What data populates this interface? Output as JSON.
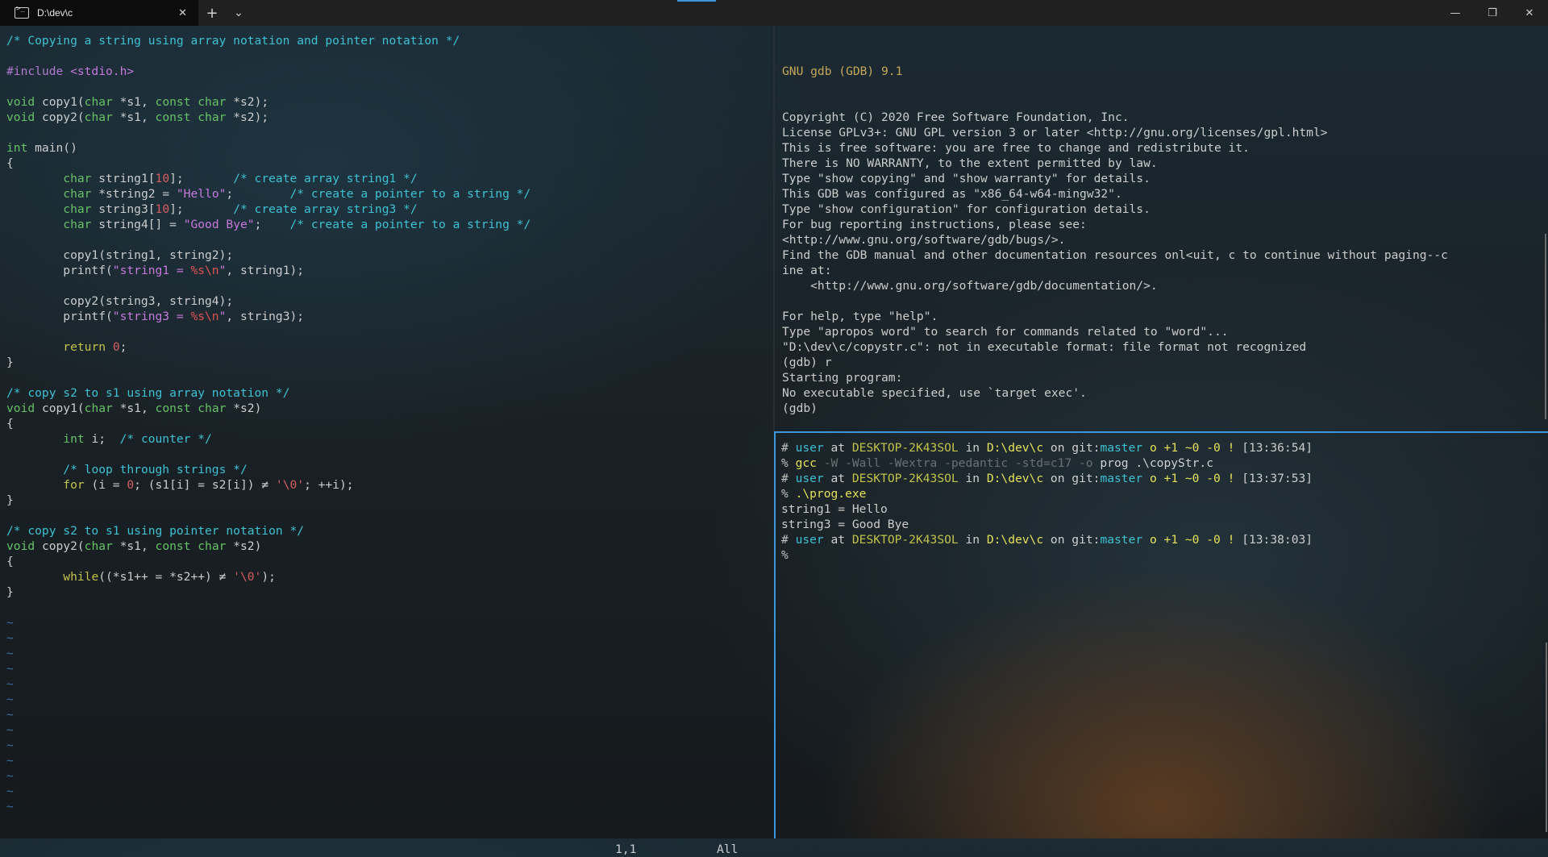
{
  "window": {
    "tab_title": "D:\\dev\\c",
    "tab_close": "✕",
    "new_tab": "+",
    "dropdown": "⌄",
    "minimize": "—",
    "maximize": "❐",
    "close": "✕"
  },
  "editor": {
    "lines": [
      [
        [
          "cmt",
          "/* Copying a string using array notation and pointer notation */"
        ]
      ],
      [],
      [
        [
          "pre",
          "#include "
        ],
        [
          "str",
          "<stdio.h>"
        ]
      ],
      [],
      [
        [
          "type",
          "void"
        ],
        [
          "fn",
          " copy1("
        ],
        [
          "type",
          "char"
        ],
        [
          "fn",
          " *s1, "
        ],
        [
          "type",
          "const char"
        ],
        [
          "fn",
          " *s2);"
        ]
      ],
      [
        [
          "type",
          "void"
        ],
        [
          "fn",
          " copy2("
        ],
        [
          "type",
          "char"
        ],
        [
          "fn",
          " *s1, "
        ],
        [
          "type",
          "const char"
        ],
        [
          "fn",
          " *s2);"
        ]
      ],
      [],
      [
        [
          "type",
          "int"
        ],
        [
          "fn",
          " main()"
        ]
      ],
      [
        [
          "fn",
          "{"
        ]
      ],
      [
        [
          "fn",
          "        "
        ],
        [
          "type",
          "char"
        ],
        [
          "fn",
          " string1["
        ],
        [
          "num",
          "10"
        ],
        [
          "fn",
          "];       "
        ],
        [
          "cmt",
          "/* create array string1 */"
        ]
      ],
      [
        [
          "fn",
          "        "
        ],
        [
          "type",
          "char"
        ],
        [
          "fn",
          " *string2 = "
        ],
        [
          "str",
          "\"Hello\""
        ],
        [
          "fn",
          ";        "
        ],
        [
          "cmt",
          "/* create a pointer to a string */"
        ]
      ],
      [
        [
          "fn",
          "        "
        ],
        [
          "type",
          "char"
        ],
        [
          "fn",
          " string3["
        ],
        [
          "num",
          "10"
        ],
        [
          "fn",
          "];       "
        ],
        [
          "cmt",
          "/* create array string3 */"
        ]
      ],
      [
        [
          "fn",
          "        "
        ],
        [
          "type",
          "char"
        ],
        [
          "fn",
          " string4[] = "
        ],
        [
          "str",
          "\"Good Bye\""
        ],
        [
          "fn",
          ";    "
        ],
        [
          "cmt",
          "/* create a pointer to a string */"
        ]
      ],
      [],
      [
        [
          "fn",
          "        copy1(string1, string2);"
        ]
      ],
      [
        [
          "fn",
          "        printf("
        ],
        [
          "str",
          "\"string1 = "
        ],
        [
          "esc",
          "%s\\n"
        ],
        [
          "str",
          "\""
        ],
        [
          "fn",
          ", string1);"
        ]
      ],
      [],
      [
        [
          "fn",
          "        copy2(string3, string4);"
        ]
      ],
      [
        [
          "fn",
          "        printf("
        ],
        [
          "str",
          "\"string3 = "
        ],
        [
          "esc",
          "%s\\n"
        ],
        [
          "str",
          "\""
        ],
        [
          "fn",
          ", string3);"
        ]
      ],
      [],
      [
        [
          "fn",
          "        "
        ],
        [
          "kw",
          "return"
        ],
        [
          "fn",
          " "
        ],
        [
          "num",
          "0"
        ],
        [
          "fn",
          ";"
        ]
      ],
      [
        [
          "fn",
          "}"
        ]
      ],
      [],
      [
        [
          "cmt",
          "/* copy s2 to s1 using array notation */"
        ]
      ],
      [
        [
          "type",
          "void"
        ],
        [
          "fn",
          " copy1("
        ],
        [
          "type",
          "char"
        ],
        [
          "fn",
          " *s1, "
        ],
        [
          "type",
          "const char"
        ],
        [
          "fn",
          " *s2)"
        ]
      ],
      [
        [
          "fn",
          "{"
        ]
      ],
      [
        [
          "fn",
          "        "
        ],
        [
          "type",
          "int"
        ],
        [
          "fn",
          " i;  "
        ],
        [
          "cmt",
          "/* counter */"
        ]
      ],
      [],
      [
        [
          "fn",
          "        "
        ],
        [
          "cmt",
          "/* loop through strings */"
        ]
      ],
      [
        [
          "fn",
          "        "
        ],
        [
          "kw",
          "for"
        ],
        [
          "fn",
          " (i = "
        ],
        [
          "num",
          "0"
        ],
        [
          "fn",
          "; (s1[i] = s2[i]) ≠ "
        ],
        [
          "num",
          "'\\0'"
        ],
        [
          "fn",
          "; ++i);"
        ]
      ],
      [
        [
          "fn",
          "}"
        ]
      ],
      [],
      [
        [
          "cmt",
          "/* copy s2 to s1 using pointer notation */"
        ]
      ],
      [
        [
          "type",
          "void"
        ],
        [
          "fn",
          " copy2("
        ],
        [
          "type",
          "char"
        ],
        [
          "fn",
          " *s1, "
        ],
        [
          "type",
          "const char"
        ],
        [
          "fn",
          " *s2)"
        ]
      ],
      [
        [
          "fn",
          "{"
        ]
      ],
      [
        [
          "fn",
          "        "
        ],
        [
          "kw",
          "while"
        ],
        [
          "fn",
          "((*s1++ = *s2++) ≠ "
        ],
        [
          "num",
          "'\\0'"
        ],
        [
          "fn",
          ");"
        ]
      ],
      [
        [
          "fn",
          "}"
        ]
      ],
      [],
      [
        [
          "tilde",
          "~"
        ]
      ],
      [
        [
          "tilde",
          "~"
        ]
      ],
      [
        [
          "tilde",
          "~"
        ]
      ],
      [
        [
          "tilde",
          "~"
        ]
      ],
      [
        [
          "tilde",
          "~"
        ]
      ],
      [
        [
          "tilde",
          "~"
        ]
      ],
      [
        [
          "tilde",
          "~"
        ]
      ],
      [
        [
          "tilde",
          "~"
        ]
      ],
      [
        [
          "tilde",
          "~"
        ]
      ],
      [
        [
          "tilde",
          "~"
        ]
      ],
      [
        [
          "tilde",
          "~"
        ]
      ],
      [
        [
          "tilde",
          "~"
        ]
      ],
      [
        [
          "tilde",
          "~"
        ]
      ]
    ],
    "status_position": "1,1",
    "status_scroll": "All"
  },
  "gdb": {
    "title": "GNU gdb (GDB) 9.1",
    "lines": [
      "Copyright (C) 2020 Free Software Foundation, Inc.",
      "License GPLv3+: GNU GPL version 3 or later <http://gnu.org/licenses/gpl.html>",
      "This is free software: you are free to change and redistribute it.",
      "There is NO WARRANTY, to the extent permitted by law.",
      "Type \"show copying\" and \"show warranty\" for details.",
      "This GDB was configured as \"x86_64-w64-mingw32\".",
      "Type \"show configuration\" for configuration details.",
      "For bug reporting instructions, please see:",
      "<http://www.gnu.org/software/gdb/bugs/>.",
      "Find the GDB manual and other documentation resources onl<uit, c to continue without paging--c",
      "ine at:",
      "    <http://www.gnu.org/software/gdb/documentation/>.",
      "",
      "For help, type \"help\".",
      "Type \"apropos word\" to search for commands related to \"word\"...",
      "\"D:\\dev\\c/copystr.c\": not in executable format: file format not recognized",
      "(gdb) r",
      "Starting program:",
      "No executable specified, use `target exec'.",
      "(gdb)"
    ]
  },
  "shell": {
    "prompt": {
      "hash": "# ",
      "user": "user",
      "at": " at ",
      "host": "DESKTOP-2K43SOL",
      "in": " in ",
      "dir": "D:\\dev\\c",
      "on": " on ",
      "git": "git:",
      "branch": "master",
      "flags": " o +1 ~0 -0 !"
    },
    "times": [
      "[13:36:54]",
      "[13:37:53]",
      "[13:38:03]"
    ],
    "cmd1_name": "gcc",
    "cmd1_args": " -W -Wall -Wextra -pedantic -std=c17 -o",
    "cmd1_rest": " prog .\\copyStr.c",
    "cmd2": ".\\prog.exe",
    "out1": "string1 = Hello",
    "out2": "string3 = Good Bye",
    "percent": "% "
  }
}
